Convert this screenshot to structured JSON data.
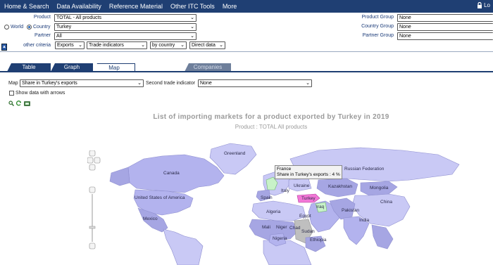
{
  "topbar": {
    "items": [
      "Home & Search",
      "Data Availability",
      "Reference Material",
      "Other ITC Tools",
      "More"
    ],
    "login_label": "Lo"
  },
  "filters": {
    "product_label": "Product",
    "product_value": "TOTAL - All products",
    "world_label": "World",
    "country_label": "Country",
    "country_value": "Turkey",
    "partner_label": "Partner",
    "partner_value": "All",
    "other_label": "other criteria",
    "flow_value": "Exports",
    "indicator_value": "Trade indicators",
    "by_value": "by country",
    "data_value": "Direct data",
    "product_group_label": "Product Group",
    "product_group_value": "None",
    "country_group_label": "Country Group",
    "country_group_value": "None",
    "partner_group_label": "Partner Group",
    "partner_group_value": "None"
  },
  "tabs": {
    "table": "Table",
    "graph": "Graph",
    "map": "Map",
    "companies": "Companies"
  },
  "map_controls": {
    "map_label": "Map",
    "map_value": "Share in Turkey's exports",
    "second_label": "Second trade indicator",
    "second_value": "None",
    "arrows_label": "Show data with arrows"
  },
  "map": {
    "title": "List of importing markets for a product exported by Turkey in 2019",
    "subtitle": "Product : TOTAL All products",
    "tooltip_country": "France",
    "tooltip_value": "Share in Turkey's exports : 4 %",
    "labels": {
      "greenland": "Greenland",
      "canada": "Canada",
      "usa": "United States of America",
      "mexico": "Mexico",
      "russia": "Russian Federation",
      "ukraine": "Ukraine",
      "kazakhstan": "Kazakhstan",
      "mongolia": "Mongolia",
      "china": "China",
      "turkey": "Turkey",
      "iraq": "Iraq",
      "pakistan": "Pakistan",
      "india": "India",
      "spain": "Spain",
      "algeria": "Algeria",
      "egypt": "Egypt",
      "mali": "Mali",
      "niger": "Niger",
      "chad": "Chad",
      "sudan": "Sudan",
      "nigeria": "Nigeria",
      "ethiopia": "Ethiopia",
      "italy": "Italy"
    },
    "colors": {
      "low": "#c9c9f5",
      "mid": "#b3b3ee",
      "dark": "#a6a6e3",
      "france": "#c8f2c8",
      "turkey": "#f277d6",
      "nodata": "#bfbfbf",
      "land_light": "#d6dcff"
    }
  }
}
